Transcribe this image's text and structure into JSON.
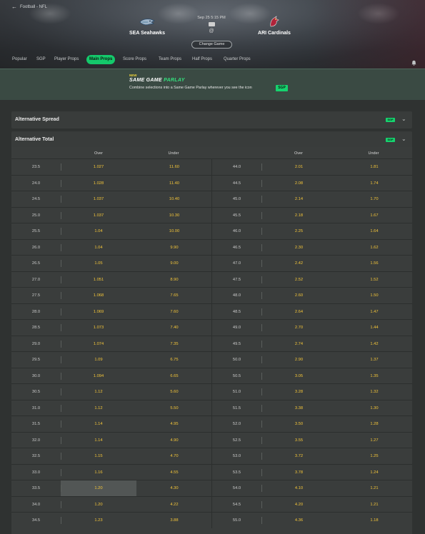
{
  "breadcrumb": {
    "label": "Football - NFL"
  },
  "match": {
    "home_team": "SEA Seahawks",
    "away_team": "ARI Cardinals",
    "datetime": "Sep 25 5:15 PM",
    "at": "@",
    "change_game": "Change Game"
  },
  "tabs": [
    "Popular",
    "SGP",
    "Player Props",
    "Main Props",
    "Score Props",
    "Team Props",
    "Half Props",
    "Quarter Props"
  ],
  "active_tab": "Main Props",
  "promo": {
    "new_label": "NEW",
    "title_main": "SAME GAME ",
    "title_accent": "PARLAY",
    "description": "Combine selections into a Same Game Parlay wherever you see the icon",
    "badge": "SGP"
  },
  "sections": {
    "spread": {
      "title": "Alternative Spread",
      "badge": "SGP"
    },
    "total": {
      "title": "Alternative Total",
      "badge": "SGP"
    }
  },
  "table": {
    "headers": {
      "over": "Over",
      "under": "Under"
    },
    "left_rows": [
      {
        "line": "23.5",
        "over": "1.027",
        "under": "11.60"
      },
      {
        "line": "24.0",
        "over": "1.028",
        "under": "11.40"
      },
      {
        "line": "24.5",
        "over": "1.037",
        "under": "10.40"
      },
      {
        "line": "25.0",
        "over": "1.037",
        "under": "10.30"
      },
      {
        "line": "25.5",
        "over": "1.04",
        "under": "10.00"
      },
      {
        "line": "26.0",
        "over": "1.04",
        "under": "9.90"
      },
      {
        "line": "26.5",
        "over": "1.05",
        "under": "9.00"
      },
      {
        "line": "27.0",
        "over": "1.051",
        "under": "8.90"
      },
      {
        "line": "27.5",
        "over": "1.068",
        "under": "7.65"
      },
      {
        "line": "28.0",
        "over": "1.069",
        "under": "7.60"
      },
      {
        "line": "28.5",
        "over": "1.073",
        "under": "7.40"
      },
      {
        "line": "29.0",
        "over": "1.074",
        "under": "7.35"
      },
      {
        "line": "29.5",
        "over": "1.09",
        "under": "6.75"
      },
      {
        "line": "30.0",
        "over": "1.094",
        "under": "6.65"
      },
      {
        "line": "30.5",
        "over": "1.12",
        "under": "5.60"
      },
      {
        "line": "31.0",
        "over": "1.12",
        "under": "5.50"
      },
      {
        "line": "31.5",
        "over": "1.14",
        "under": "4.95"
      },
      {
        "line": "32.0",
        "over": "1.14",
        "under": "4.90"
      },
      {
        "line": "32.5",
        "over": "1.15",
        "under": "4.70"
      },
      {
        "line": "33.0",
        "over": "1.16",
        "under": "4.55"
      },
      {
        "line": "33.5",
        "over": "1.20",
        "under": "4.30"
      },
      {
        "line": "34.0",
        "over": "1.20",
        "under": "4.22"
      },
      {
        "line": "34.5",
        "over": "1.23",
        "under": "3.88"
      }
    ],
    "right_rows": [
      {
        "line": "44.0",
        "over": "2.01",
        "under": "1.81"
      },
      {
        "line": "44.5",
        "over": "2.08",
        "under": "1.74"
      },
      {
        "line": "45.0",
        "over": "2.14",
        "under": "1.70"
      },
      {
        "line": "45.5",
        "over": "2.18",
        "under": "1.67"
      },
      {
        "line": "46.0",
        "over": "2.25",
        "under": "1.64"
      },
      {
        "line": "46.5",
        "over": "2.30",
        "under": "1.62"
      },
      {
        "line": "47.0",
        "over": "2.42",
        "under": "1.56"
      },
      {
        "line": "47.5",
        "over": "2.52",
        "under": "1.52"
      },
      {
        "line": "48.0",
        "over": "2.60",
        "under": "1.50"
      },
      {
        "line": "48.5",
        "over": "2.64",
        "under": "1.47"
      },
      {
        "line": "49.0",
        "over": "2.70",
        "under": "1.44"
      },
      {
        "line": "49.5",
        "over": "2.74",
        "under": "1.42"
      },
      {
        "line": "50.0",
        "over": "2.90",
        "under": "1.37"
      },
      {
        "line": "50.5",
        "over": "3.05",
        "under": "1.35"
      },
      {
        "line": "51.0",
        "over": "3.28",
        "under": "1.32"
      },
      {
        "line": "51.5",
        "over": "3.38",
        "under": "1.30"
      },
      {
        "line": "52.0",
        "over": "3.50",
        "under": "1.28"
      },
      {
        "line": "52.5",
        "over": "3.55",
        "under": "1.27"
      },
      {
        "line": "53.0",
        "over": "3.72",
        "under": "1.25"
      },
      {
        "line": "53.5",
        "over": "3.78",
        "under": "1.24"
      },
      {
        "line": "54.0",
        "over": "4.10",
        "under": "1.21"
      },
      {
        "line": "54.5",
        "over": "4.20",
        "under": "1.21"
      },
      {
        "line": "55.0",
        "over": "4.36",
        "under": "1.18"
      }
    ],
    "hovered_left_row": 20
  },
  "colors": {
    "accent_green": "#14c96b",
    "odds_yellow": "#f3c53a",
    "background": "#2f3231"
  },
  "icons": [
    "back-arrow-icon",
    "seahawks-logo-icon",
    "cardinals-logo-icon",
    "tv-icon",
    "bell-icon",
    "close-icon",
    "chevron-down-icon"
  ]
}
